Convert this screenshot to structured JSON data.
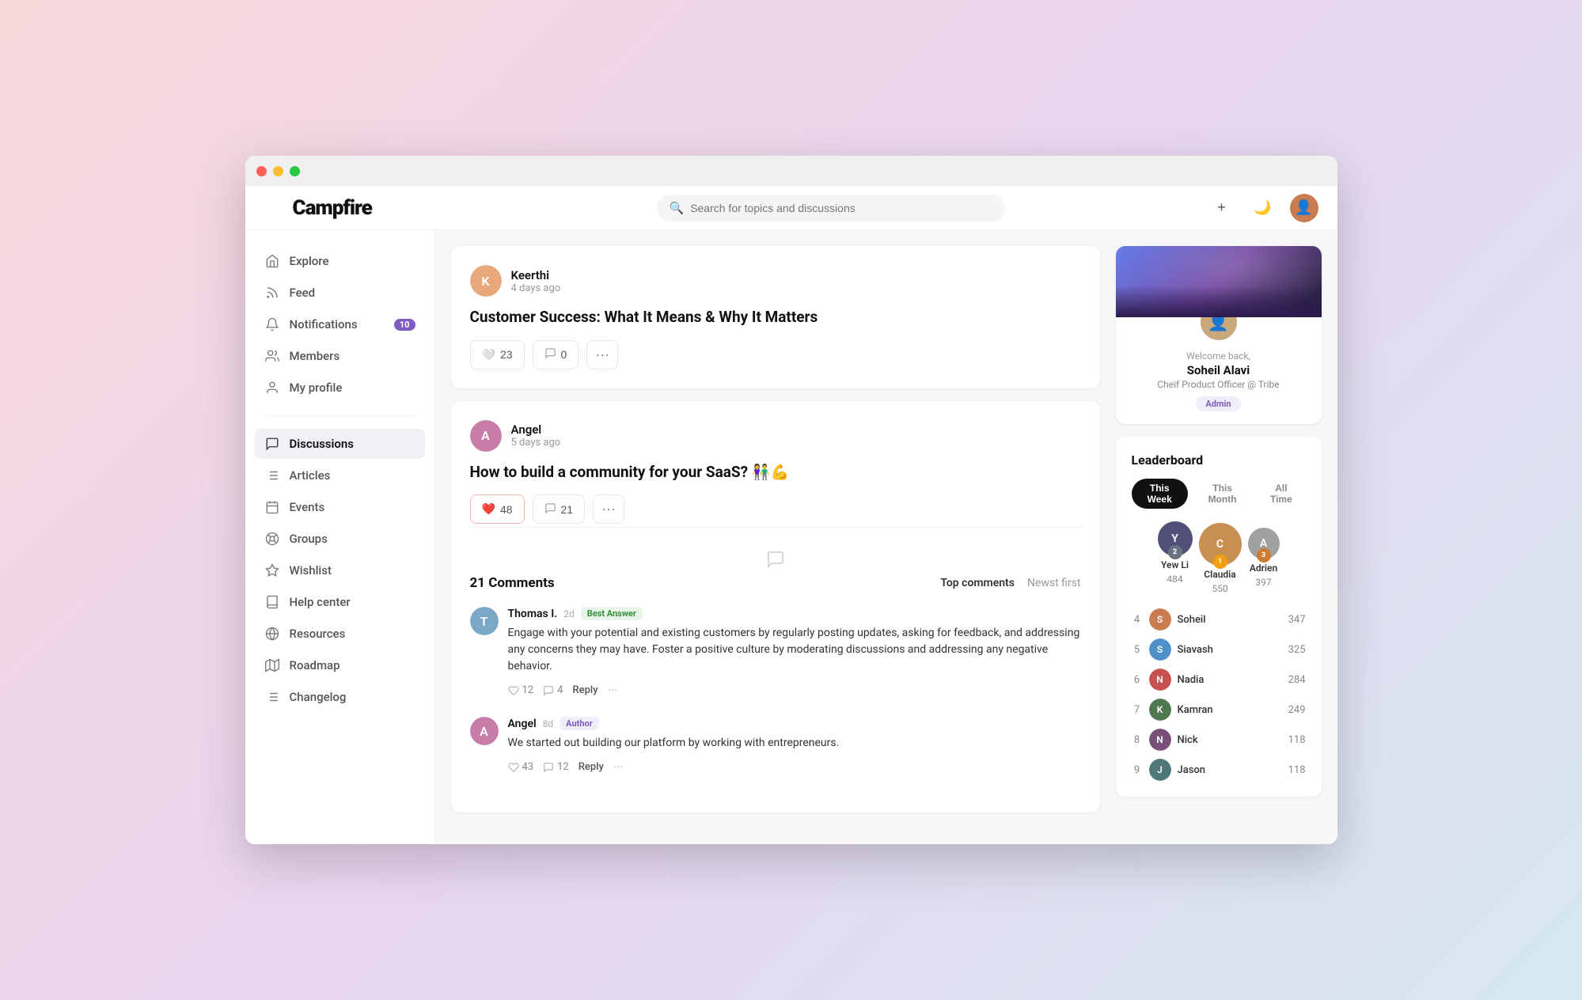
{
  "app": {
    "title": "Campfire"
  },
  "topbar": {
    "search_placeholder": "Search for topics and discussions",
    "add_label": "+",
    "dark_mode_icon": "moon",
    "user_avatar": "profile"
  },
  "sidebar": {
    "logo": "Campfire",
    "nav_items": [
      {
        "id": "explore",
        "label": "Explore",
        "icon": "home"
      },
      {
        "id": "feed",
        "label": "Feed",
        "icon": "feed"
      },
      {
        "id": "notifications",
        "label": "Notifications",
        "icon": "bell",
        "badge": "10"
      },
      {
        "id": "members",
        "label": "Members",
        "icon": "members"
      },
      {
        "id": "my-profile",
        "label": "My profile",
        "icon": "person"
      }
    ],
    "nav_items2": [
      {
        "id": "discussions",
        "label": "Discussions",
        "icon": "chat",
        "active": true
      },
      {
        "id": "articles",
        "label": "Articles",
        "icon": "list"
      },
      {
        "id": "events",
        "label": "Events",
        "icon": "calendar"
      },
      {
        "id": "groups",
        "label": "Groups",
        "icon": "groups"
      },
      {
        "id": "wishlist",
        "label": "Wishlist",
        "icon": "star"
      },
      {
        "id": "help-center",
        "label": "Help center",
        "icon": "book"
      },
      {
        "id": "resources",
        "label": "Resources",
        "icon": "globe"
      },
      {
        "id": "roadmap",
        "label": "Roadmap",
        "icon": "map"
      },
      {
        "id": "changelog",
        "label": "Changelog",
        "icon": "changelog"
      }
    ]
  },
  "posts": [
    {
      "id": "post1",
      "author": "Keerthi",
      "time": "4 days ago",
      "title": "Customer Success: What It Means & Why It Matters",
      "likes": 23,
      "comments": 0,
      "liked": false
    },
    {
      "id": "post2",
      "author": "Angel",
      "time": "5 days ago",
      "title": "How to build a community for your SaaS? 👫💪",
      "likes": 48,
      "comments": 21,
      "liked": true,
      "comments_data": {
        "count": 21,
        "count_label": "21 Comments",
        "sort_options": [
          "Top comments",
          "Newst first"
        ],
        "items": [
          {
            "id": "c1",
            "author": "Thomas I.",
            "time": "2d",
            "badge": "Best Answer",
            "badge_type": "best",
            "text": "Engage with your potential and existing customers by regularly posting updates, asking for feedback, and addressing any concerns they may have. Foster a positive culture by moderating discussions and addressing any negative behavior.",
            "likes": 12,
            "replies_count": 4,
            "reply_label": "Reply"
          },
          {
            "id": "c2",
            "author": "Angel",
            "time": "8d",
            "badge": "Author",
            "badge_type": "author",
            "text": "We started out building our platform by working with entrepreneurs.",
            "likes": 43,
            "replies_count": 12,
            "reply_label": "Reply"
          }
        ]
      }
    }
  ],
  "profile_card": {
    "welcome_text": "Welcome back,",
    "name": "Soheil Alavi",
    "role": "Cheif Product Officer @ Tribe",
    "badge": "Admin"
  },
  "leaderboard": {
    "title": "Leaderboard",
    "tabs": [
      "This Week",
      "This Month",
      "All Time"
    ],
    "active_tab": "This Week",
    "top3": [
      {
        "rank": 2,
        "name": "Yew Li",
        "score": 484,
        "color": "#505078"
      },
      {
        "rank": 1,
        "name": "Claudia",
        "score": 550,
        "color": "#c89050"
      },
      {
        "rank": 3,
        "name": "Adrien",
        "score": 397,
        "color": "#a0a0a0"
      }
    ],
    "list": [
      {
        "rank": 4,
        "name": "Soheil",
        "score": 347,
        "color": "#c87c50"
      },
      {
        "rank": 5,
        "name": "Siavash",
        "score": 325,
        "color": "#5090c8"
      },
      {
        "rank": 6,
        "name": "Nadia",
        "score": 284,
        "color": "#c85050"
      },
      {
        "rank": 7,
        "name": "Kamran",
        "score": 249,
        "color": "#507850"
      },
      {
        "rank": 8,
        "name": "Nick",
        "score": 118,
        "color": "#785078"
      },
      {
        "rank": 9,
        "name": "Jason",
        "score": 118,
        "color": "#507878"
      }
    ]
  }
}
